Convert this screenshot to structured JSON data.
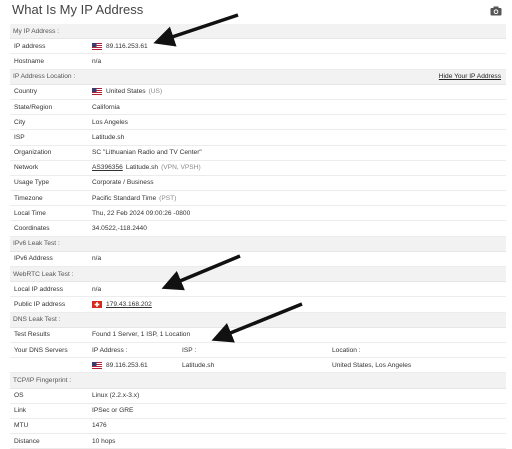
{
  "title": "What Is My IP Address",
  "sections": {
    "my_ip": "My IP Address :",
    "location": "IP Address Location :",
    "hide_ip": "Hide Your IP Address",
    "ipv6": "IPv6 Leak Test :",
    "webrtc": "WebRTC Leak Test :",
    "dns": "DNS Leak Test :",
    "tcpip": "TCP/IP Fingerprint :"
  },
  "my_ip": {
    "ip_label": "IP address",
    "ip_value": "89.116.253.61",
    "hostname_label": "Hostname",
    "hostname_value": "n/a"
  },
  "location": {
    "country_label": "Country",
    "country_value": "United States",
    "country_code": "(US)",
    "region_label": "State/Region",
    "region_value": "California",
    "city_label": "City",
    "city_value": "Los Angeles",
    "isp_label": "ISP",
    "isp_value": "Latitude.sh",
    "org_label": "Organization",
    "org_value": "SC \"Lithuanian Radio and TV Center\"",
    "network_label": "Network",
    "network_as": "AS396356",
    "network_name": "Latitude.sh",
    "network_note": "(VPN, VPSH)",
    "usage_label": "Usage Type",
    "usage_value": "Corporate / Business",
    "tz_label": "Timezone",
    "tz_value": "Pacific Standard Time",
    "tz_abbr": "(PST)",
    "time_label": "Local Time",
    "time_value": "Thu, 22 Feb 2024 09:00:26 -0800",
    "coord_label": "Coordinates",
    "coord_value": "34.0522,-118.2440"
  },
  "ipv6": {
    "label": "IPv6 Address",
    "value": "n/a"
  },
  "webrtc": {
    "local_label": "Local IP address",
    "local_value": "n/a",
    "public_label": "Public IP address",
    "public_value": "179.43.168.202"
  },
  "dns": {
    "results_label": "Test Results",
    "results_value": "Found 1 Server, 1 ISP, 1 Location",
    "servers_label": "Your DNS Servers",
    "col_ip": "IP Address :",
    "col_isp": "ISP :",
    "col_location": "Location :",
    "row_ip": "89.116.253.61",
    "row_isp": "Latitude.sh",
    "row_location": "United States, Los Angeles"
  },
  "tcpip": {
    "os_label": "OS",
    "os_value": "Linux (2.2.x-3.x)",
    "link_label": "Link",
    "link_value": "IPSec or GRE",
    "mtu_label": "MTU",
    "mtu_value": "1476",
    "distance_label": "Distance",
    "distance_value": "10 hops"
  },
  "colors": {
    "arrow": "#111111",
    "section_bg": "#f2f2f2",
    "swiss_red": "#d52b1e"
  }
}
